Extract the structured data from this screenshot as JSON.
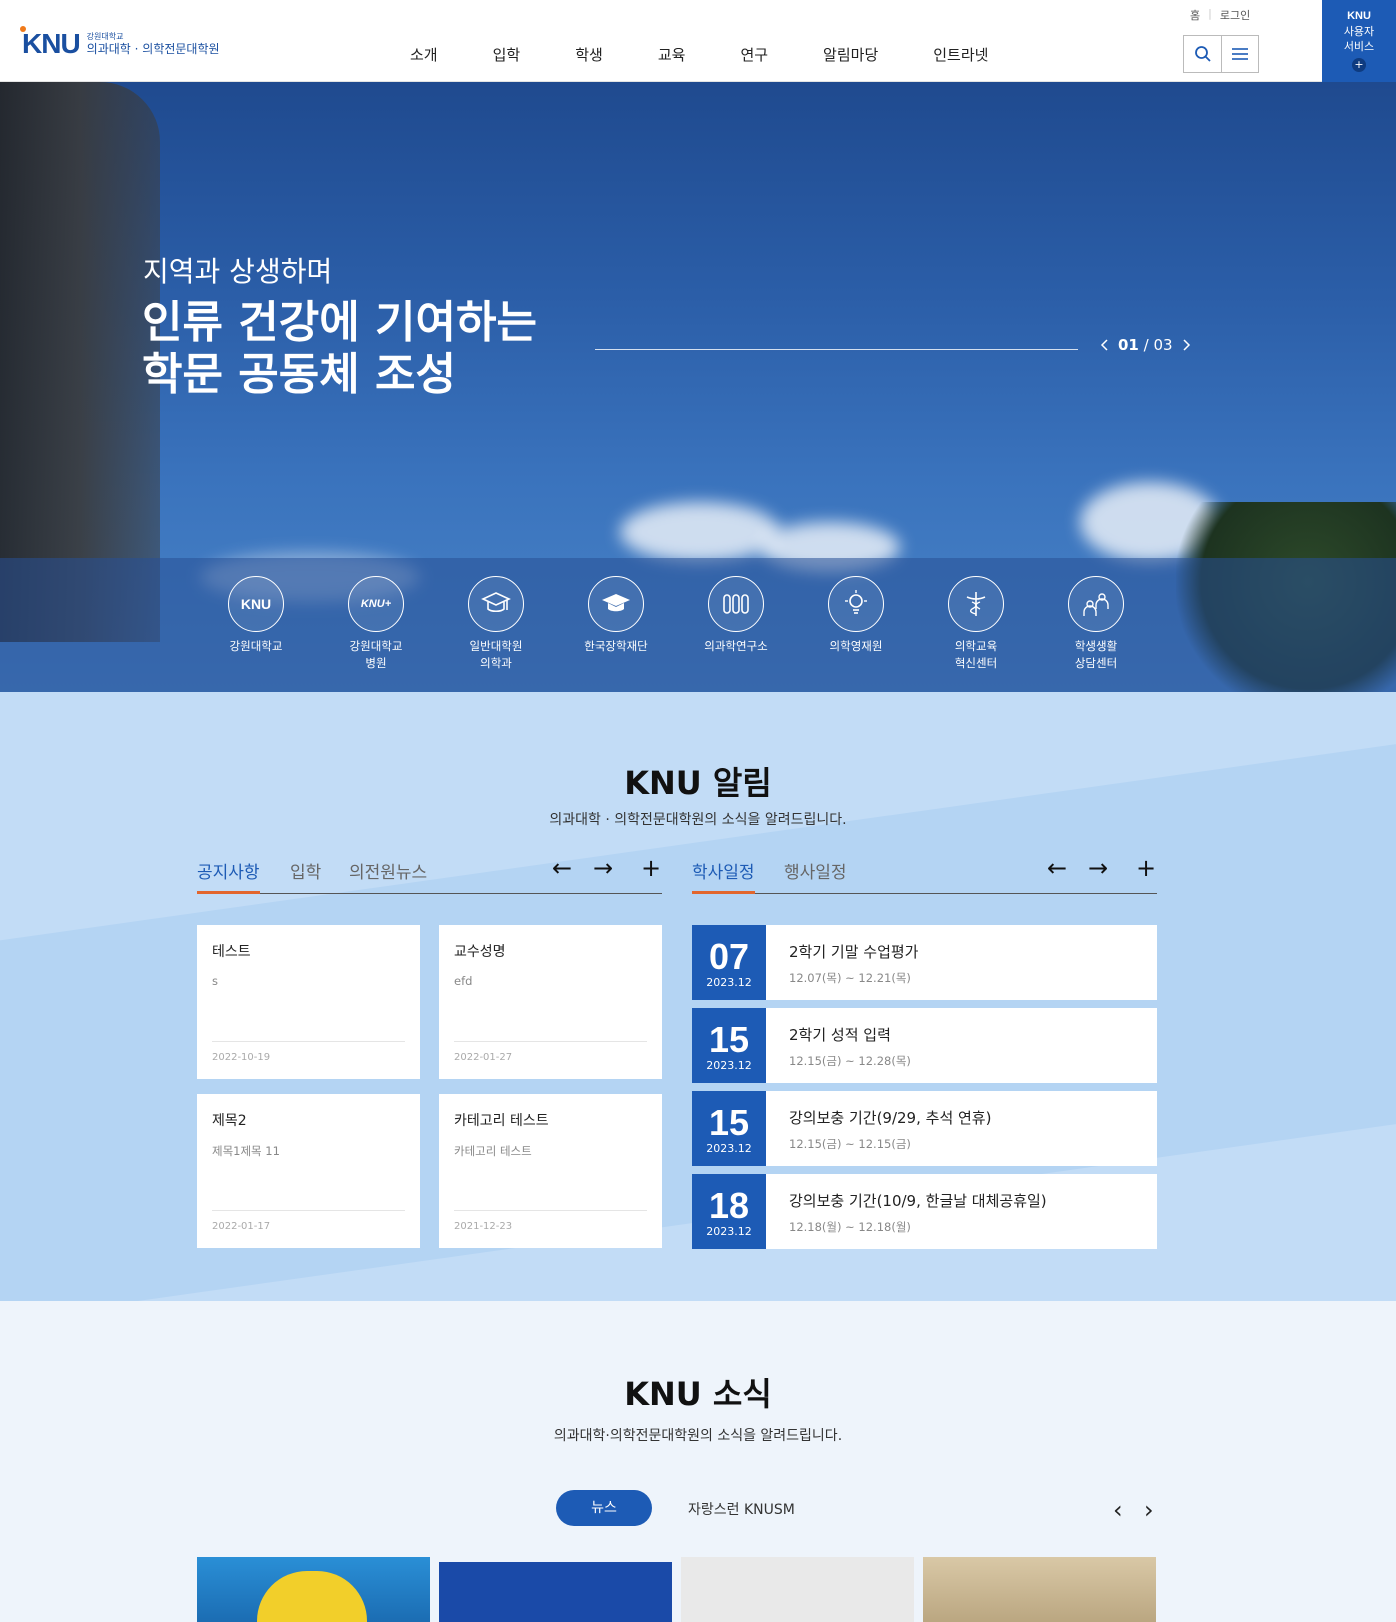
{
  "header": {
    "logo_mark": "KNU",
    "logo_sub": "강원대학교",
    "logo_main": "의과대학 · 의학전문대학원",
    "nav": [
      "소개",
      "입학",
      "학생",
      "교육",
      "연구",
      "알림마당",
      "인트라넷"
    ],
    "util": [
      "홈",
      "로그인"
    ],
    "knu_service": [
      "KNU",
      "사용자",
      "서비스"
    ],
    "knu_service_plus": "+"
  },
  "hero": {
    "subtitle": "지역과 상생하며",
    "title_line1": "인류 건강에 기여하는",
    "title_line2": "학문 공동체 조성",
    "pager_current": "01",
    "pager_sep": " / ",
    "pager_total": "03"
  },
  "quick_links": [
    {
      "label1": "강원대학교",
      "label2": "",
      "icon": "knu-logo-icon"
    },
    {
      "label1": "강원대학교",
      "label2": "병원",
      "icon": "knu-hospital-icon"
    },
    {
      "label1": "일반대학원",
      "label2": "의학과",
      "icon": "graduation-cap-icon"
    },
    {
      "label1": "한국장학재단",
      "label2": "",
      "icon": "mortarboard-icon"
    },
    {
      "label1": "의과학연구소",
      "label2": "",
      "icon": "test-tubes-icon"
    },
    {
      "label1": "의학영재원",
      "label2": "",
      "icon": "lightbulb-icon"
    },
    {
      "label1": "의학교육",
      "label2": "혁신센터",
      "icon": "caduceus-icon"
    },
    {
      "label1": "학생생활",
      "label2": "상담센터",
      "icon": "counseling-icon"
    }
  ],
  "notice_section": {
    "title": "KNU 알림",
    "desc": "의과대학 · 의학전문대학원의 소식을 알려드립니다.",
    "left_tabs": [
      "공지사항",
      "입학",
      "의전원뉴스"
    ],
    "right_tabs": [
      "학사일정",
      "행사일정"
    ],
    "ctrl_prev": "←",
    "ctrl_next": "→",
    "ctrl_more": "+",
    "cards": [
      {
        "title": "테스트",
        "desc": "s",
        "date": "2022-10-19"
      },
      {
        "title": "교수성명",
        "desc": "efd",
        "date": "2022-01-27"
      },
      {
        "title": "제목2",
        "desc": "제목1제목 11",
        "date": "2022-01-17"
      },
      {
        "title": "카테고리 테스트",
        "desc": "카테고리 테스트",
        "date": "2021-12-23"
      }
    ],
    "schedule": [
      {
        "day": "07",
        "month": "2023.12",
        "title": "2학기 기말 수업평가",
        "range": "12.07(목) ~ 12.21(목)"
      },
      {
        "day": "15",
        "month": "2023.12",
        "title": "2학기 성적 입력",
        "range": "12.15(금) ~ 12.28(목)"
      },
      {
        "day": "15",
        "month": "2023.12",
        "title": "강의보충 기간(9/29, 추석 연휴)",
        "range": "12.15(금) ~ 12.15(금)"
      },
      {
        "day": "18",
        "month": "2023.12",
        "title": "강의보충 기간(10/9, 한글날 대체공휴일)",
        "range": "12.18(월) ~ 12.18(월)"
      }
    ]
  },
  "news_section": {
    "title": "KNU 소식",
    "desc": "의과대학·의학전문대학원의 소식을 알려드립니다.",
    "tab_active": "뉴스",
    "tab_other": "자랑스런 KNUSM",
    "prev": "‹",
    "next": "›"
  },
  "colors": {
    "brand": "#1d5bb5",
    "accent": "#e2662d",
    "notice_bg": "#c2dcf6"
  }
}
